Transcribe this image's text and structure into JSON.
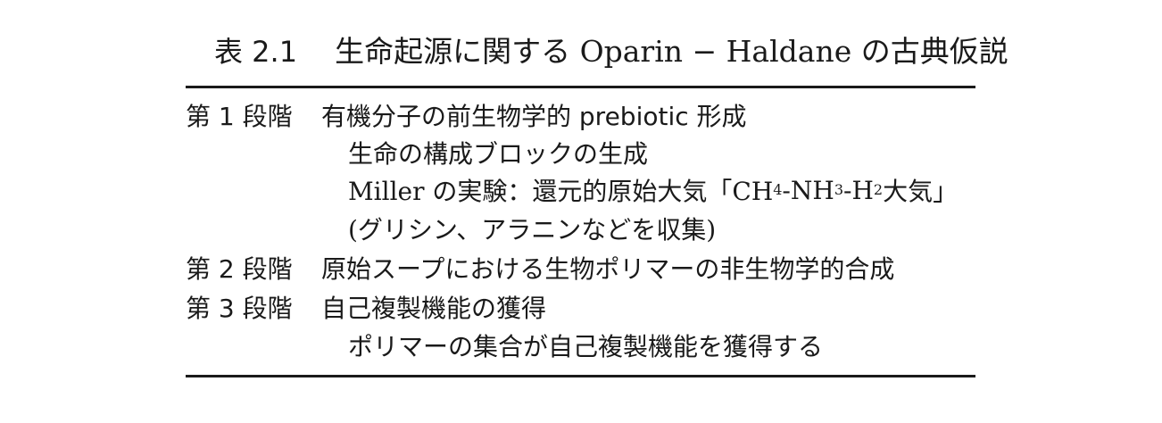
{
  "table": {
    "label": "表 2.1",
    "title": "生命起源に関する Oparin − Haldane の古典仮説"
  },
  "stages": [
    {
      "label": "第 1 段階",
      "title": "有機分子の前生物学的 prebiotic 形成",
      "details": [
        "生命の構成ブロックの生成",
        "(グリシン、アラニンなどを収集)"
      ],
      "experiment": {
        "prefix": "Miller の実験：還元的原始大気「CH",
        "sub1": "4",
        "mid1": "-NH",
        "sub2": "3",
        "mid2": "-H",
        "sub3": "2",
        "suffix": " 大気」"
      }
    },
    {
      "label": "第 2 段階",
      "title": "原始スープにおける生物ポリマーの非生物学的合成"
    },
    {
      "label": "第 3 段階",
      "title": "自己複製機能の獲得",
      "details": [
        "ポリマーの集合が自己複製機能を獲得する"
      ]
    }
  ]
}
